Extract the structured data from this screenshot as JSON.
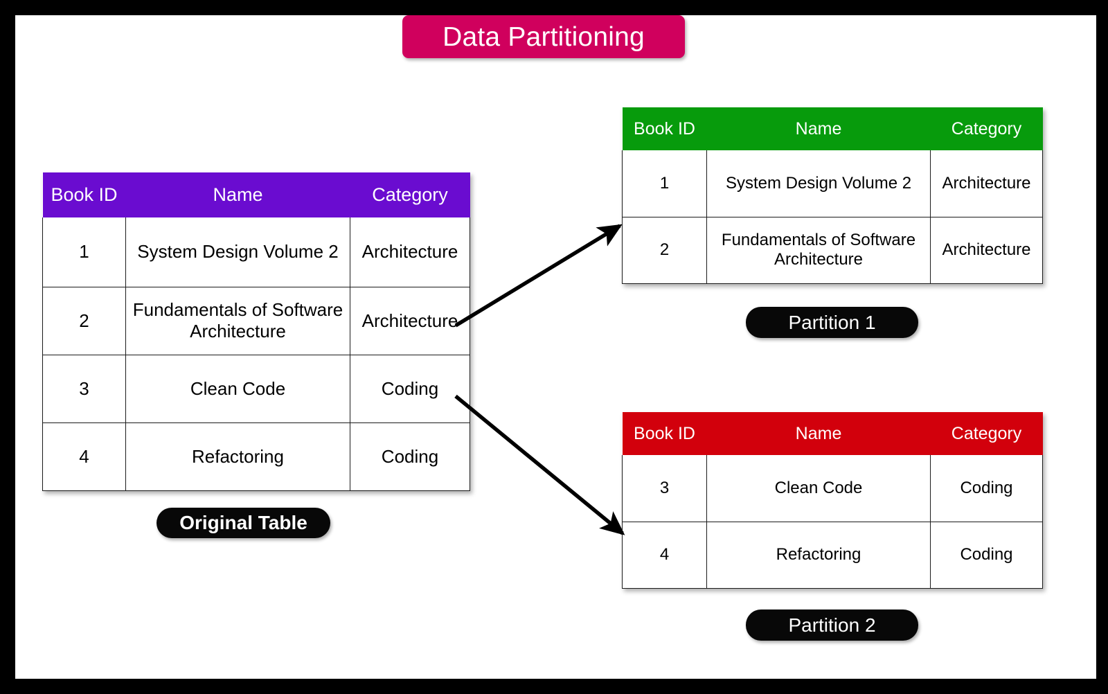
{
  "page": {
    "title_banner": "Data Partitioning",
    "background": "#ffffff",
    "frame_color": "#000000"
  },
  "colors": {
    "banner_pink": "#d0005d",
    "original_header_purple": "#6a0cd0",
    "partition1_header_green": "#079b0c",
    "partition2_header_red": "#d2000c",
    "label_pill_black": "#080808",
    "table_border": "#1a1a1a",
    "arrow": "#000000"
  },
  "original_table": {
    "label": "Original Table",
    "columns": [
      "Book ID",
      "Name",
      "Category"
    ],
    "rows": [
      {
        "book_id": "1",
        "name": "System Design Volume 2",
        "category": "Architecture"
      },
      {
        "book_id": "2",
        "name": "Fundamentals of Software Architecture",
        "category": "Architecture"
      },
      {
        "book_id": "3",
        "name": "Clean Code",
        "category": "Coding"
      },
      {
        "book_id": "4",
        "name": "Refactoring",
        "category": "Coding"
      }
    ]
  },
  "partition1_table": {
    "label": "Partition 1",
    "columns": [
      "Book ID",
      "Name",
      "Category"
    ],
    "rows": [
      {
        "book_id": "1",
        "name": "System Design Volume 2",
        "category": "Architecture"
      },
      {
        "book_id": "2",
        "name": "Fundamentals of Software Architecture",
        "category": "Architecture"
      }
    ]
  },
  "partition2_table": {
    "label": "Partition 2",
    "columns": [
      "Book ID",
      "Name",
      "Category"
    ],
    "rows": [
      {
        "book_id": "3",
        "name": "Clean Code",
        "category": "Coding"
      },
      {
        "book_id": "4",
        "name": "Refactoring",
        "category": "Coding"
      }
    ]
  },
  "arrows": [
    {
      "name": "arrow-to-partition-1",
      "from": "original-table",
      "to": "partition1-table"
    },
    {
      "name": "arrow-to-partition-2",
      "from": "original-table",
      "to": "partition2-table"
    }
  ]
}
